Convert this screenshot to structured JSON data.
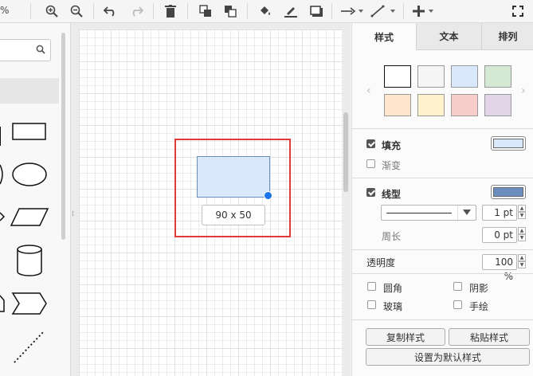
{
  "toolbar": {
    "zoom": "%",
    "icons": [
      "zoom-in-icon",
      "zoom-out-icon",
      "undo-icon",
      "redo-icon",
      "delete-icon",
      "to-front-icon",
      "to-back-icon",
      "fill-color-icon",
      "line-color-icon",
      "shadow-icon",
      "connection-icon",
      "waypoints-icon",
      "insert-icon",
      "fullscreen-icon"
    ]
  },
  "canvas": {
    "size_label": "90 x 50",
    "shape_fill": "#dae8fc",
    "shape_stroke": "#6c8ebf",
    "highlight_color": "#e03a3a"
  },
  "panel": {
    "tabs": [
      "样式",
      "文本",
      "排列"
    ],
    "swatches": [
      "#ffffff",
      "#f5f5f5",
      "#dae8fc",
      "#d5e8d4",
      "#ffe6cc",
      "#fff2cc",
      "#f8cecc",
      "#e1d5e7"
    ],
    "fill": {
      "label": "填充",
      "checked": true,
      "color": "#dae8fc"
    },
    "gradient": {
      "label": "渐变",
      "checked": false
    },
    "line": {
      "label": "线型",
      "checked": true,
      "color": "#6c8ebf",
      "width": "1 pt"
    },
    "perimeter": {
      "label": "周长",
      "value": "0 pt"
    },
    "opacity": {
      "label": "透明度",
      "value": "100 %"
    },
    "rounded": {
      "label": "圆角",
      "checked": false
    },
    "shadow": {
      "label": "阴影",
      "checked": false
    },
    "glass": {
      "label": "玻璃",
      "checked": false
    },
    "sketch": {
      "label": "手绘",
      "checked": false
    },
    "copy_style": "复制样式",
    "paste_style": "粘贴样式",
    "set_default": "设置为默认样式"
  }
}
